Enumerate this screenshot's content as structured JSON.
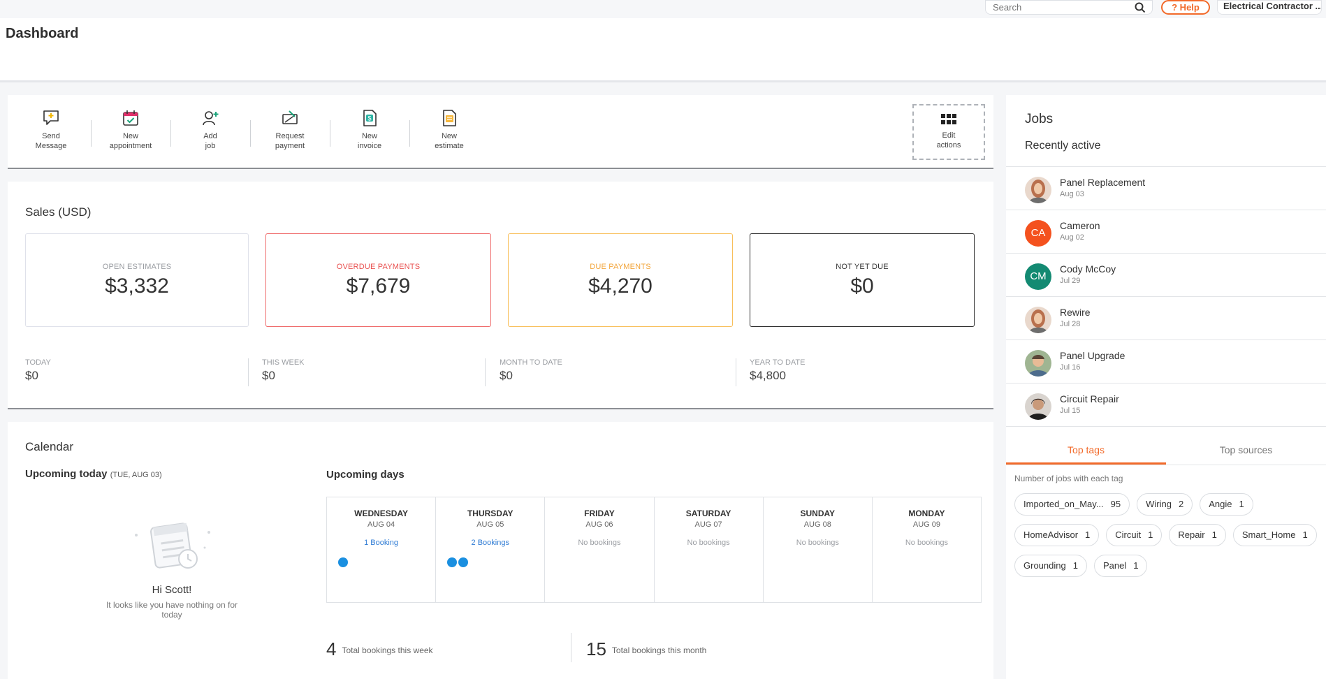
{
  "header": {
    "title": "Dashboard",
    "search_placeholder": "Search",
    "help_label": "? Help",
    "account_label": "Electrical Contractor ..."
  },
  "actions": [
    {
      "label": "Send\nMessage",
      "icon": "message-icon"
    },
    {
      "label": "New\nappointment",
      "icon": "calendar-icon"
    },
    {
      "label": "Add\njob",
      "icon": "add-user-icon"
    },
    {
      "label": "Request\npayment",
      "icon": "payment-icon"
    },
    {
      "label": "New\ninvoice",
      "icon": "invoice-icon"
    },
    {
      "label": "New\nestimate",
      "icon": "estimate-icon"
    }
  ],
  "edit_actions_label": "Edit\nactions",
  "sales": {
    "title": "Sales (USD)",
    "cards": [
      {
        "label": "OPEN ESTIMATES",
        "value": "$3,332",
        "color": "#dfe1ea",
        "label_color": "#9a9da2"
      },
      {
        "label": "OVERDUE PAYMENTS",
        "value": "$7,679",
        "color": "#ef6a6a",
        "label_color": "#e9504f"
      },
      {
        "label": "DUE PAYMENTS",
        "value": "$4,270",
        "color": "#f8bf5b",
        "label_color": "#f3a53a"
      },
      {
        "label": "NOT YET DUE",
        "value": "$0",
        "color": "#2d2d2d",
        "label_color": "#333333"
      }
    ],
    "periods": [
      {
        "label": "TODAY",
        "value": "$0"
      },
      {
        "label": "THIS WEEK",
        "value": "$0"
      },
      {
        "label": "MONTH TO DATE",
        "value": "$0"
      },
      {
        "label": "YEAR TO DATE",
        "value": "$4,800"
      }
    ]
  },
  "calendar": {
    "title": "Calendar",
    "upcoming_today": "Upcoming today",
    "today_date": "(TUE, AUG 03)",
    "greeting": "Hi Scott!",
    "empty_message": "It looks like you have nothing on for today",
    "upcoming_days_title": "Upcoming days",
    "days": [
      {
        "name": "WEDNESDAY",
        "date": "AUG 04",
        "bookings": "1 Booking",
        "dots": 1
      },
      {
        "name": "THURSDAY",
        "date": "AUG 05",
        "bookings": "2 Bookings",
        "dots": 2
      },
      {
        "name": "FRIDAY",
        "date": "AUG 06",
        "bookings": "No bookings",
        "dots": 0
      },
      {
        "name": "SATURDAY",
        "date": "AUG 07",
        "bookings": "No bookings",
        "dots": 0
      },
      {
        "name": "SUNDAY",
        "date": "AUG 08",
        "bookings": "No bookings",
        "dots": 0
      },
      {
        "name": "MONDAY",
        "date": "AUG 09",
        "bookings": "No bookings",
        "dots": 0
      }
    ],
    "week_total": "4",
    "week_total_label": "Total bookings this week",
    "month_total": "15",
    "month_total_label": "Total bookings this month"
  },
  "jobs": {
    "title": "Jobs",
    "recent_title": "Recently active",
    "items": [
      {
        "name": "Panel Replacement",
        "date": "Aug 03",
        "avatar": "photo",
        "initials": "",
        "color": "#b9704d"
      },
      {
        "name": "Cameron",
        "date": "Aug 02",
        "avatar": "initials",
        "initials": "CA",
        "color": "#f4511e"
      },
      {
        "name": "Cody McCoy",
        "date": "Jul 29",
        "avatar": "initials",
        "initials": "CM",
        "color": "#138a72"
      },
      {
        "name": "Rewire",
        "date": "Jul 28",
        "avatar": "photo",
        "initials": "",
        "color": "#b9704d"
      },
      {
        "name": "Panel Upgrade",
        "date": "Jul 16",
        "avatar": "photo",
        "initials": "",
        "color": "#6f8a62"
      },
      {
        "name": "Circuit Repair",
        "date": "Jul 15",
        "avatar": "photo",
        "initials": "",
        "color": "#3b3330"
      }
    ],
    "tabs": [
      "Top tags",
      "Top sources"
    ],
    "tags_caption": "Number of jobs with each tag",
    "tags": [
      {
        "name": "Imported_on_May...",
        "count": "95"
      },
      {
        "name": "Wiring",
        "count": "2"
      },
      {
        "name": "Angie",
        "count": "1"
      },
      {
        "name": "HomeAdvisor",
        "count": "1"
      },
      {
        "name": "Circuit",
        "count": "1"
      },
      {
        "name": "Repair",
        "count": "1"
      },
      {
        "name": "Smart_Home",
        "count": "1"
      },
      {
        "name": "Grounding",
        "count": "1"
      },
      {
        "name": "Panel",
        "count": "1"
      }
    ]
  }
}
